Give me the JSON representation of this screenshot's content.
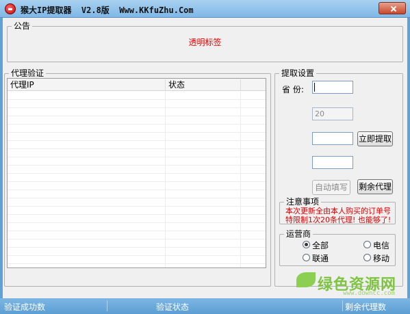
{
  "window": {
    "title": "猴大IP提取器  V2.8版  Www.KKfuZhu.Com"
  },
  "notice": {
    "legend": "公告",
    "text": "透明标签"
  },
  "proxy_verify": {
    "legend": "代理验证",
    "columns": [
      "代理IP",
      "状态"
    ],
    "rows": []
  },
  "extract": {
    "legend": "提取设置",
    "province_label": "省  份:",
    "province_value": "",
    "count_value": "20",
    "field3_value": "",
    "field4_value": "",
    "extract_button": "立即提取",
    "autofill_button": "自动填写",
    "remaining_button": "剩余代理"
  },
  "notes": {
    "legend": "注意事项",
    "line1": "本次更新全由本人购买的订单号",
    "line2": "特限制1次20条代理! 也能够了!"
  },
  "carrier": {
    "legend": "运营商",
    "options": [
      "全部",
      "电信",
      "联通",
      "移动"
    ],
    "selected": "全部"
  },
  "statusbar": {
    "verified_count": "验证成功数",
    "verify_state": "验证状态",
    "remaining_count": "剩余代理数"
  },
  "watermark": {
    "text": "绿色资源网",
    "url": "www.downcc.com"
  },
  "colors": {
    "notice_text": "#e00000",
    "titlebar": "#7fb8e6",
    "statusbar": "#5c9ed3"
  }
}
